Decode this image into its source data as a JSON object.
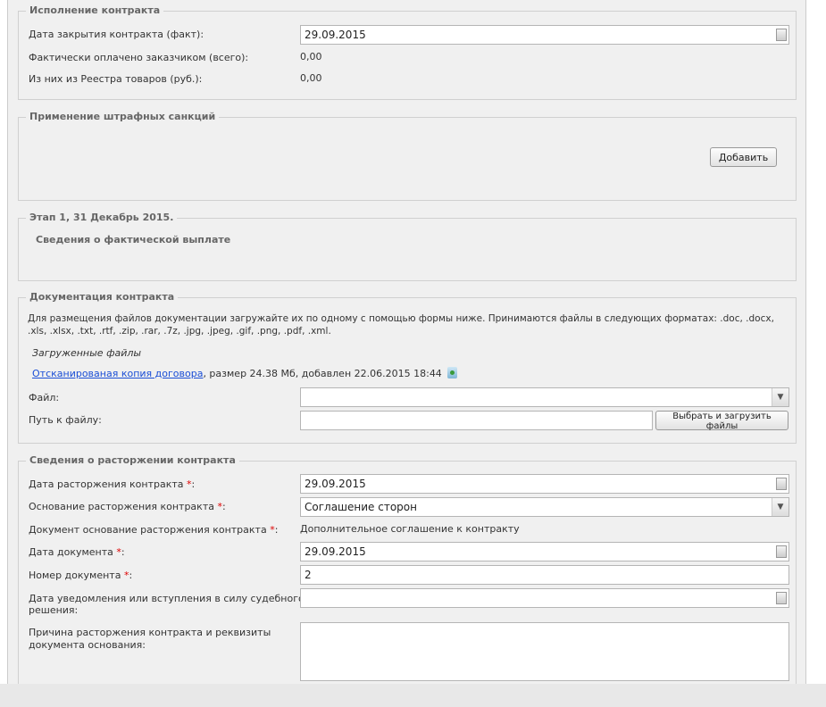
{
  "execution": {
    "legend": "Исполнение контракта",
    "close_date_label": "Дата закрытия контракта (факт):",
    "close_date_value": "29.09.2015",
    "paid_label": "Фактически оплачено заказчиком (всего):",
    "paid_value": "0,00",
    "registry_label": "Из них из Реестра товаров (руб.):",
    "registry_value": "0,00"
  },
  "penalties": {
    "legend": "Применение штрафных санкций",
    "add_button": "Добавить"
  },
  "stage": {
    "legend": "Этап 1, 31 Декабрь 2015.",
    "subtitle": "Сведения о фактической выплате"
  },
  "docs": {
    "legend": "Документация контракта",
    "info_line1": "Для размещения файлов документации загружайте их по одному с помощью формы ниже. Принимаются файлы в следующих форматах: .doc, .docx,",
    "info_line2": ".xls, .xlsx, .txt, .rtf, .zip, .rar, .7z, .jpg, .jpeg, .gif, .png, .pdf, .xml.",
    "uploaded_title": "Загруженные файлы",
    "file_link": "Отсканированая копия договора",
    "file_meta": ", размер 24.38 Мб, добавлен 22.06.2015 18:44",
    "file_label": "Файл:",
    "file_value": "",
    "path_label": "Путь к файлу:",
    "path_value": "",
    "upload_button": "Выбрать и загрузить файлы"
  },
  "termination": {
    "legend": "Сведения о расторжении контракта",
    "req": "*",
    "date_label": "Дата расторжения контракта",
    "date_value": "29.09.2015",
    "basis_label": "Основание расторжения контракта",
    "basis_value": "Соглашение сторон",
    "doc_basis_label": "Документ основание расторжения контракта",
    "doc_basis_value": "Дополнительное соглашение к контракту",
    "doc_date_label": "Дата документа",
    "doc_date_value": "29.09.2015",
    "doc_num_label": "Номер документа",
    "doc_num_value": "2",
    "notice_label_1": "Дата уведомления или вступления в силу судебного",
    "notice_label_2": "решения:",
    "notice_value": "",
    "reason_label_1": "Причина расторжения контракта и реквизиты",
    "reason_label_2": "документа основания:",
    "reason_value": "",
    "colon": ":"
  }
}
